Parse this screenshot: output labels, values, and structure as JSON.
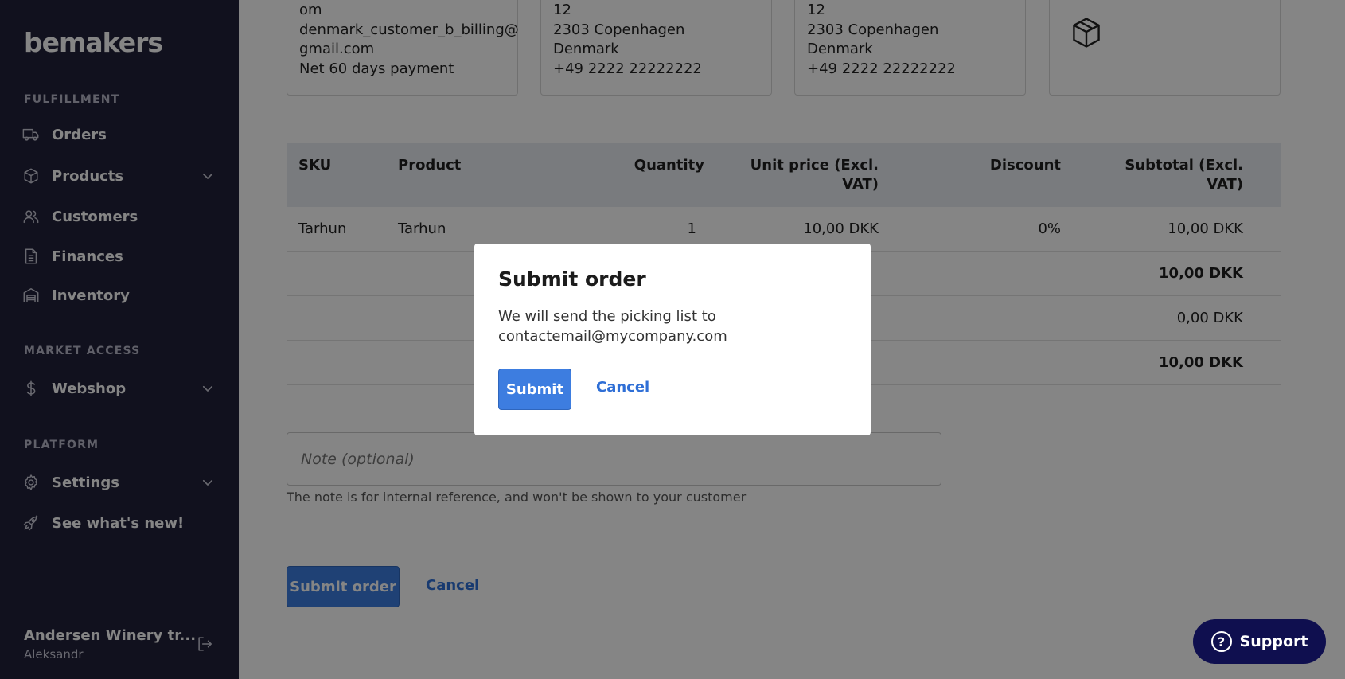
{
  "app": {
    "logo": "bemakers"
  },
  "sidebar": {
    "sections": [
      {
        "label": "FULFILLMENT"
      },
      {
        "label": "MARKET ACCESS"
      },
      {
        "label": "PLATFORM"
      }
    ],
    "items": [
      {
        "label": "Orders",
        "icon": "truck-icon"
      },
      {
        "label": "Products",
        "icon": "box-icon",
        "has_chevron": true
      },
      {
        "label": "Customers",
        "icon": "users-icon"
      },
      {
        "label": "Finances",
        "icon": "document-icon"
      },
      {
        "label": "Inventory",
        "icon": "warehouse-icon"
      },
      {
        "label": "Webshop",
        "icon": "dollar-icon",
        "has_chevron": true
      },
      {
        "label": "Settings",
        "icon": "gear-icon",
        "has_chevron": true
      },
      {
        "label": "See what's new!",
        "icon": "rocket-icon"
      }
    ],
    "footer": {
      "org": "Andersen Winery tr...",
      "user": "Aleksandr"
    }
  },
  "cards": {
    "billing": [
      "om",
      "denmark_customer_b_billing@",
      "gmail.com",
      "Net 60 days payment"
    ],
    "shipping": [
      "12",
      "2303 Copenhagen",
      "Denmark",
      "+49 2222 22222222"
    ],
    "invoice": [
      "12",
      "2303 Copenhagen",
      "Denmark",
      "+49 2222 22222222"
    ]
  },
  "table": {
    "headers": {
      "sku": "SKU",
      "product": "Product",
      "quantity": "Quantity",
      "unit_price_1": "Unit price (Excl.",
      "unit_price_2": "VAT)",
      "discount": "Discount",
      "subtotal_1": "Subtotal (Excl.",
      "subtotal_2": "VAT)"
    },
    "rows": [
      {
        "sku": "Tarhun",
        "product": "Tarhun",
        "quantity": "1",
        "unit_price": "10,00 DKK",
        "discount": "0%",
        "subtotal": "10,00 DKK"
      }
    ],
    "totals": [
      "10,00 DKK",
      "0,00 DKK",
      "10,00 DKK"
    ]
  },
  "note": {
    "placeholder": "Note (optional)",
    "help": "The note is for internal reference, and won't be shown to your customer"
  },
  "actions": {
    "submit": "Submit order",
    "cancel": "Cancel"
  },
  "support": {
    "label": "Support"
  },
  "modal": {
    "title": "Submit order",
    "body_line1": "We will send the picking list to",
    "body_line2": "contactemail@mycompany.com",
    "submit": "Submit",
    "cancel": "Cancel"
  }
}
